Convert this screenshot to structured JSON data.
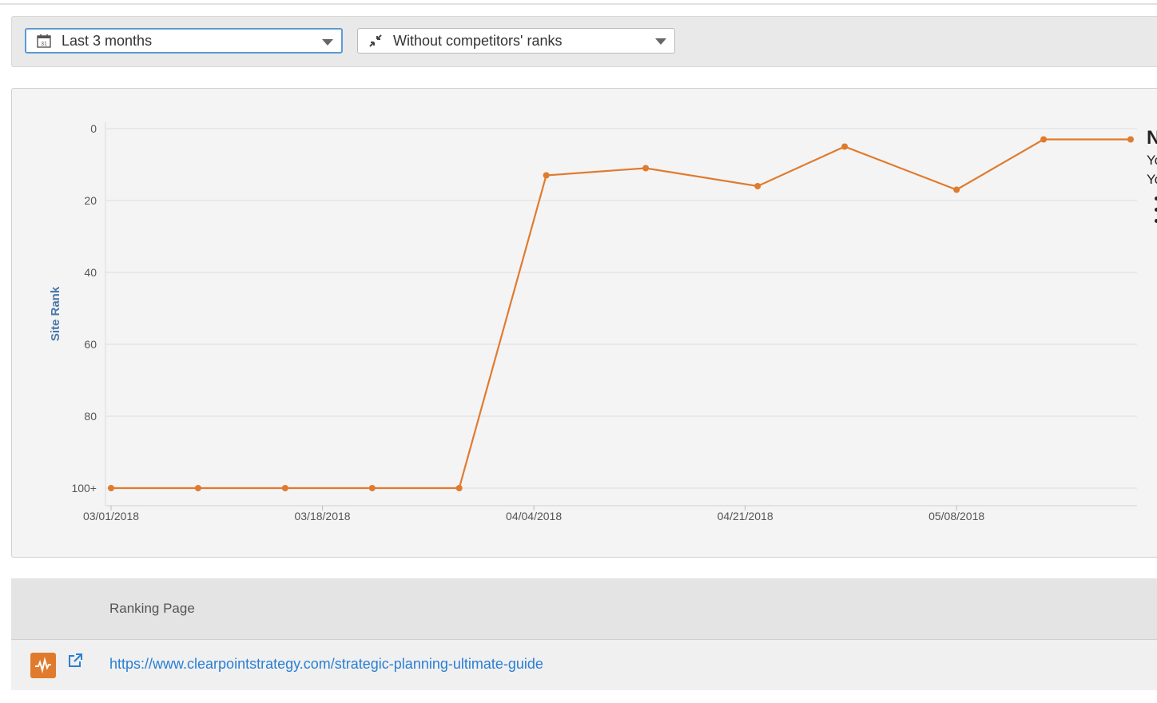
{
  "filters": {
    "date_range": {
      "value": "Last 3 months",
      "icon": "calendar-icon"
    },
    "competitors": {
      "value": "Without competitors' ranks",
      "icon": "collapse-arrows-icon"
    }
  },
  "chart_data": {
    "type": "line",
    "ylabel": "Site Rank",
    "xlabel": "",
    "y_reversed": true,
    "ylim": [
      0,
      100
    ],
    "y_ticks": [
      "0",
      "20",
      "40",
      "60",
      "80",
      "100+"
    ],
    "x_ticks": [
      "03/01/2018",
      "03/18/2018",
      "04/04/2018",
      "04/21/2018",
      "05/08/2018"
    ],
    "x": [
      "2018-03-01",
      "2018-03-08",
      "2018-03-15",
      "2018-03-22",
      "2018-03-29",
      "2018-04-05",
      "2018-04-13",
      "2018-04-22",
      "2018-04-29",
      "2018-05-08",
      "2018-05-15",
      "2018-05-22"
    ],
    "series": [
      {
        "values": [
          100,
          100,
          100,
          100,
          100,
          13,
          11,
          16,
          5,
          17,
          3,
          3
        ],
        "color": "#e07b2e"
      }
    ],
    "grid": true
  },
  "side_note": {
    "heading": "N",
    "lines": [
      "Yo",
      "Yo"
    ],
    "bullets": 3
  },
  "table": {
    "header": "Ranking Page",
    "rows": [
      {
        "url": "https://www.clearpointstrategy.com/strategic-planning-ultimate-guide"
      }
    ]
  }
}
